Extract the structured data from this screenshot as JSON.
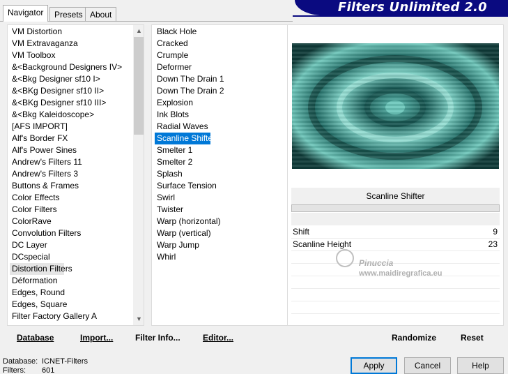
{
  "tabs": [
    "Navigator",
    "Presets",
    "About"
  ],
  "app_title": "Filters Unlimited 2.0",
  "categories": {
    "items": [
      "VM Distortion",
      "VM Extravaganza",
      "VM Toolbox",
      "&<Background Designers IV>",
      "&<Bkg Designer sf10 I>",
      "&<BKg Designer sf10 II>",
      "&<BKg Designer sf10 III>",
      "&<Bkg Kaleidoscope>",
      "[AFS IMPORT]",
      "Alf's Border FX",
      "Alf's Power Sines",
      "Andrew's Filters 11",
      "Andrew's Filters 3",
      "Buttons & Frames",
      "Color Effects",
      "Color Filters",
      "ColorRave",
      "Convolution Filters",
      "DC Layer",
      "DCspecial",
      "Distortion Filters",
      "Déformation",
      "Edges, Round",
      "Edges, Square",
      "Filter Factory Gallery A"
    ],
    "selected": "Distortion Filters"
  },
  "filters": {
    "items": [
      "Black Hole",
      "Cracked",
      "Crumple",
      "Deformer",
      "Down The Drain 1",
      "Down The Drain 2",
      "Explosion",
      "Ink Blots",
      "Radial Waves",
      "Scanline Shifter",
      "Smelter 1",
      "Smelter 2",
      "Splash",
      "Surface Tension",
      "Swirl",
      "Twister",
      "Warp (horizontal)",
      "Warp (vertical)",
      "Warp Jump",
      "Whirl"
    ],
    "selected": "Scanline Shifter"
  },
  "filter_title": "Scanline Shifter",
  "params": [
    {
      "label": "Shift",
      "value": "9"
    },
    {
      "label": "Scanline Height",
      "value": "23"
    }
  ],
  "watermark": {
    "name": "Pinuccia",
    "url": "www.maidiregrafica.eu"
  },
  "bottom_bar": {
    "database": "Database",
    "import": "Import...",
    "filter_info": "Filter Info...",
    "editor": "Editor...",
    "randomize": "Randomize",
    "reset": "Reset"
  },
  "status": {
    "database_label": "Database:",
    "database_value": "ICNET-Filters",
    "filters_label": "Filters:",
    "filters_value": "601"
  },
  "dialog_buttons": {
    "apply": "Apply",
    "cancel": "Cancel",
    "help": "Help"
  },
  "colors": {
    "accent": "#0078d7",
    "banner": "#0a0a80",
    "preview_teal": "#3aa39a"
  }
}
